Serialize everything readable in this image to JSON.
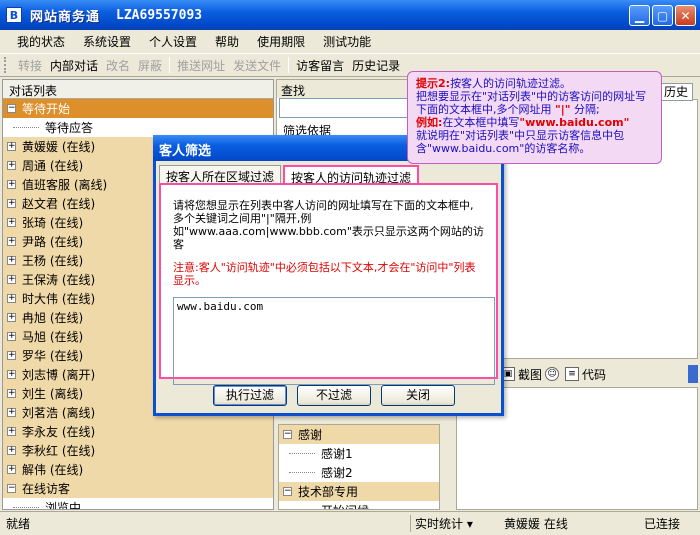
{
  "window": {
    "app_icon": "B",
    "title": "网站商务通",
    "id": "LZA69557093"
  },
  "menu": [
    "我的状态",
    "系统设置",
    "个人设置",
    "帮助",
    "使用期限",
    "测试功能"
  ],
  "toolbar": {
    "transfer": "转接",
    "internal_chat": "内部对话",
    "rename": "改名",
    "block": "屏蔽",
    "push_url": "推送网址",
    "send_file": "发送文件",
    "visitor_msg": "访客留言",
    "history": "历史记录"
  },
  "left_panel": {
    "header": "对话列表",
    "rows": [
      {
        "type": "group",
        "text": "等待开始",
        "sign": "⊟",
        "selected": true
      },
      {
        "type": "child",
        "text": "等待应答"
      },
      {
        "type": "group",
        "text": "黄媛媛 (在线)",
        "sign": "⊞"
      },
      {
        "type": "group",
        "text": "周通 (在线)",
        "sign": "⊞"
      },
      {
        "type": "group",
        "text": "值班客服 (离线)",
        "sign": "⊞"
      },
      {
        "type": "group",
        "text": "赵文君 (在线)",
        "sign": "⊞"
      },
      {
        "type": "group",
        "text": "张琦 (在线)",
        "sign": "⊞"
      },
      {
        "type": "group",
        "text": "尹路 (在线)",
        "sign": "⊞"
      },
      {
        "type": "group",
        "text": "王杨 (在线)",
        "sign": "⊞"
      },
      {
        "type": "group",
        "text": "王保涛 (在线)",
        "sign": "⊞"
      },
      {
        "type": "group",
        "text": "时大伟 (在线)",
        "sign": "⊞"
      },
      {
        "type": "group",
        "text": "冉旭 (在线)",
        "sign": "⊞"
      },
      {
        "type": "group",
        "text": "马旭 (在线)",
        "sign": "⊞"
      },
      {
        "type": "group",
        "text": "罗华 (在线)",
        "sign": "⊞"
      },
      {
        "type": "group",
        "text": "刘志博 (离开)",
        "sign": "⊞"
      },
      {
        "type": "group",
        "text": "刘生 (离线)",
        "sign": "⊞"
      },
      {
        "type": "group",
        "text": "刘茗浩 (离线)",
        "sign": "⊞"
      },
      {
        "type": "group",
        "text": "李永友 (在线)",
        "sign": "⊞"
      },
      {
        "type": "group",
        "text": "李秋红 (在线)",
        "sign": "⊞"
      },
      {
        "type": "group",
        "text": "解伟 (在线)",
        "sign": "⊞"
      },
      {
        "type": "group",
        "text": "在线访客",
        "sign": "⊟"
      },
      {
        "type": "child",
        "text": "浏览中"
      }
    ]
  },
  "search": {
    "header": "查找",
    "label": "筛选依据"
  },
  "history_tab": "历史",
  "mid_toolbar": {
    "screenshot": "截图",
    "code": "代码"
  },
  "quick_reply": {
    "rows": [
      {
        "type": "group",
        "text": "感谢",
        "sign": "⊟"
      },
      {
        "type": "child",
        "text": "感谢1"
      },
      {
        "type": "child",
        "text": "感谢2"
      },
      {
        "type": "group",
        "text": "技术部专用",
        "sign": "⊟"
      },
      {
        "type": "child",
        "text": "开始问候"
      }
    ]
  },
  "status": {
    "ready": "就绪",
    "stats": "实时统计",
    "user": "黄媛媛 在线",
    "connection": "已连接"
  },
  "dialog": {
    "title": "客人筛选",
    "tab_region": "按客人所在区域过滤",
    "tab_trace": "按客人的访问轨迹过滤",
    "desc": "请将您想显示在列表中客人访问的网址填写在下面的文本框中,多个关键词之间用\"|\"隔开,例如\"www.aaa.com|www.bbb.com\"表示只显示这两个网站的访客",
    "note": "注意:客人\"访问轨迹\"中必须包括以下文本,才会在\"访问中\"列表显示。",
    "textarea_value": "www.baidu.com",
    "btn_apply": "执行过滤",
    "btn_none": "不过滤",
    "btn_close": "关闭"
  },
  "hint": {
    "label": "提示2:",
    "title": "按客人的访问轨迹过滤。",
    "body": "把想要显示在\"对话列表\"中的访客访问的网址写下面的文本框中,多个网址用",
    "separator": "\"|\"",
    "body_end": "分隔;",
    "example_label": "例如:",
    "example_text": "在文本框中填写",
    "example_url": "\"www.baidu.com\"",
    "explain": "就说明在\"对话列表\"中只显示访客信息中包含\"www.baidu.com\"的访客名称。"
  },
  "colors": {
    "accent": "#ff4da6",
    "title_blue": "#0a50d0",
    "note_red": "#e00000",
    "hint_bg": "#f4d9f4"
  }
}
